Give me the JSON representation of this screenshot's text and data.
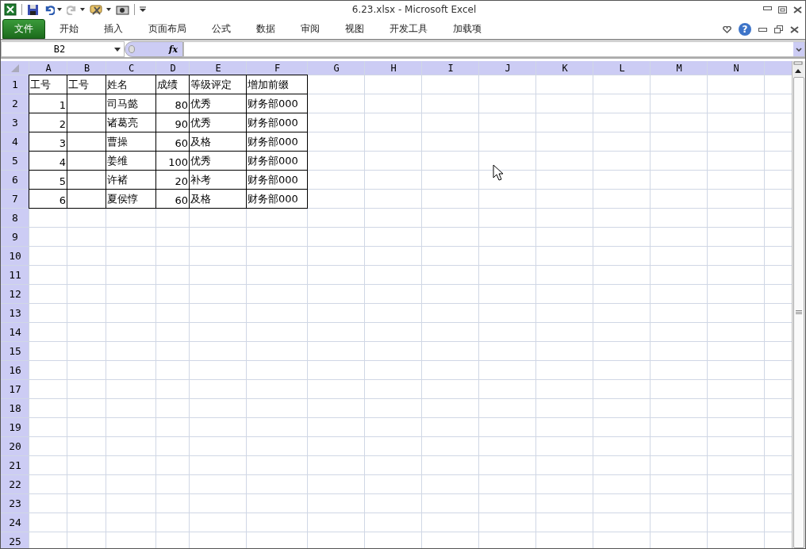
{
  "title_bar": {
    "title": "6.23.xlsx  -  Microsoft Excel"
  },
  "ribbon": {
    "tabs": [
      {
        "label": "文件",
        "kind": "file",
        "selected": false
      },
      {
        "label": "开始",
        "kind": "tab",
        "selected": false
      },
      {
        "label": "插入",
        "kind": "tab",
        "selected": false
      },
      {
        "label": "页面布局",
        "kind": "tab",
        "selected": false
      },
      {
        "label": "公式",
        "kind": "tab",
        "selected": false
      },
      {
        "label": "数据",
        "kind": "tab",
        "selected": false
      },
      {
        "label": "审阅",
        "kind": "tab",
        "selected": false
      },
      {
        "label": "视图",
        "kind": "tab",
        "selected": false
      },
      {
        "label": "开发工具",
        "kind": "tab",
        "selected": false
      },
      {
        "label": "加载项",
        "kind": "tab",
        "selected": false
      }
    ],
    "help": "?"
  },
  "formula_bar": {
    "name_box": "B2",
    "function_label": "fx"
  },
  "sheet": {
    "columns": [
      "A",
      "B",
      "C",
      "D",
      "E",
      "F",
      "G",
      "H",
      "I",
      "J",
      "K",
      "L",
      "M",
      "N"
    ],
    "rows": [
      {
        "number": "1",
        "cells": [
          {
            "kind": "text",
            "value": "工号"
          },
          {
            "kind": "text",
            "value": "工号"
          },
          {
            "kind": "text",
            "value": "姓名"
          },
          {
            "kind": "text",
            "value": "成绩"
          },
          {
            "kind": "text",
            "value": "等级评定"
          },
          {
            "kind": "text",
            "value": "增加前缀"
          }
        ]
      },
      {
        "number": "2",
        "cells": [
          {
            "kind": "number",
            "value": "1"
          },
          {
            "kind": "empty"
          },
          {
            "kind": "text",
            "value": "司马懿"
          },
          {
            "kind": "number",
            "value": "80"
          },
          {
            "kind": "text",
            "value": "优秀"
          },
          {
            "kind": "text",
            "value": "财务部000"
          }
        ]
      },
      {
        "number": "3",
        "cells": [
          {
            "kind": "number",
            "value": "2"
          },
          {
            "kind": "empty"
          },
          {
            "kind": "text",
            "value": "诸葛亮"
          },
          {
            "kind": "number",
            "value": "90"
          },
          {
            "kind": "text",
            "value": "优秀"
          },
          {
            "kind": "text",
            "value": "财务部000"
          }
        ]
      },
      {
        "number": "4",
        "cells": [
          {
            "kind": "number",
            "value": "3"
          },
          {
            "kind": "empty"
          },
          {
            "kind": "text",
            "value": "曹操"
          },
          {
            "kind": "number",
            "value": "60"
          },
          {
            "kind": "text",
            "value": "及格"
          },
          {
            "kind": "text",
            "value": "财务部000"
          }
        ]
      },
      {
        "number": "5",
        "cells": [
          {
            "kind": "number",
            "value": "4"
          },
          {
            "kind": "empty"
          },
          {
            "kind": "text",
            "value": "姜维"
          },
          {
            "kind": "number",
            "value": "100"
          },
          {
            "kind": "text",
            "value": "优秀"
          },
          {
            "kind": "text",
            "value": "财务部000"
          }
        ]
      },
      {
        "number": "6",
        "cells": [
          {
            "kind": "number",
            "value": "5"
          },
          {
            "kind": "empty"
          },
          {
            "kind": "text",
            "value": "许褚"
          },
          {
            "kind": "number",
            "value": "20"
          },
          {
            "kind": "text",
            "value": "补考"
          },
          {
            "kind": "text",
            "value": "财务部000"
          }
        ]
      },
      {
        "number": "7",
        "cells": [
          {
            "kind": "number",
            "value": "6"
          },
          {
            "kind": "empty"
          },
          {
            "kind": "text",
            "value": "夏侯惇"
          },
          {
            "kind": "number",
            "value": "60"
          },
          {
            "kind": "text",
            "value": "及格"
          },
          {
            "kind": "text",
            "value": "财务部000"
          }
        ]
      },
      {
        "number": "8"
      },
      {
        "number": "9"
      },
      {
        "number": "10"
      },
      {
        "number": "11"
      },
      {
        "number": "12"
      },
      {
        "number": "13"
      },
      {
        "number": "14"
      },
      {
        "number": "15"
      },
      {
        "number": "16"
      },
      {
        "number": "17"
      },
      {
        "number": "18"
      },
      {
        "number": "19"
      },
      {
        "number": "20"
      },
      {
        "number": "21"
      },
      {
        "number": "22"
      },
      {
        "number": "23"
      },
      {
        "number": "24"
      },
      {
        "number": "25"
      }
    ]
  }
}
